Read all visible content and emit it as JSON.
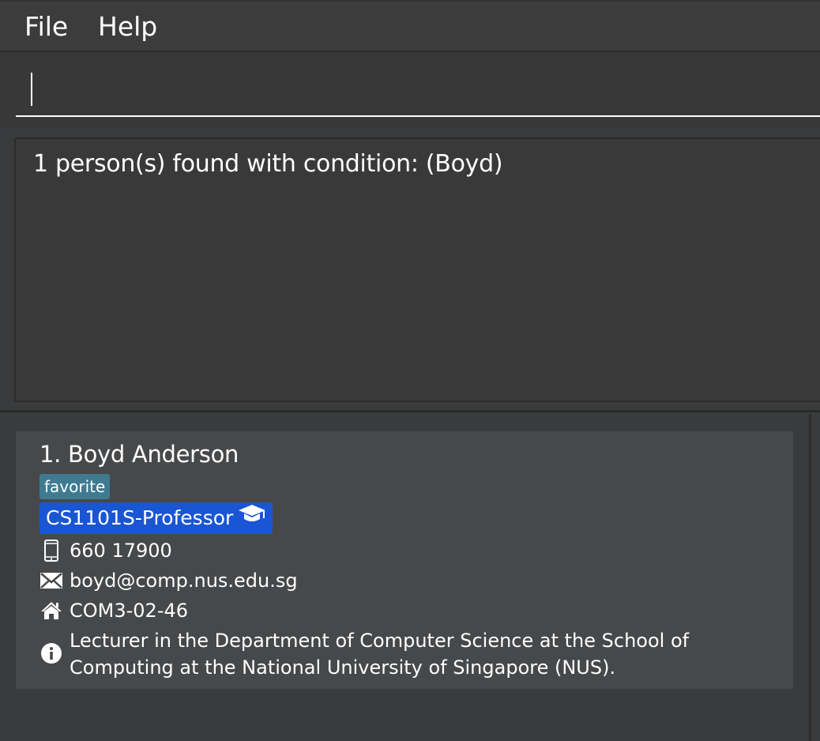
{
  "menu": {
    "items": [
      {
        "label": "File"
      },
      {
        "label": "Help"
      }
    ]
  },
  "command_box": {
    "value": ""
  },
  "result_display": {
    "text": "1 person(s) found with condition: (Boyd)"
  },
  "person_list": [
    {
      "index_name": "1. Boyd Anderson",
      "tags": [
        "favorite"
      ],
      "role_tag": "CS1101S-Professor",
      "role_icon": "graduation-cap-icon",
      "phone": "660 17900",
      "email": "boyd@comp.nus.edu.sg",
      "address": "COM3-02-46",
      "remark": "Lecturer in the Department of Computer Science at the School of Computing at the National University of Singapore (NUS).",
      "icons": {
        "phone": "phone-icon",
        "email": "envelope-icon",
        "address": "home-icon",
        "remark": "info-icon"
      }
    }
  ],
  "colors": {
    "background": "#3a3b3c",
    "card": "#46484a",
    "favorite_tag": "#3e7b91",
    "role_tag": "#1a55d4",
    "text": "#ffffff"
  }
}
